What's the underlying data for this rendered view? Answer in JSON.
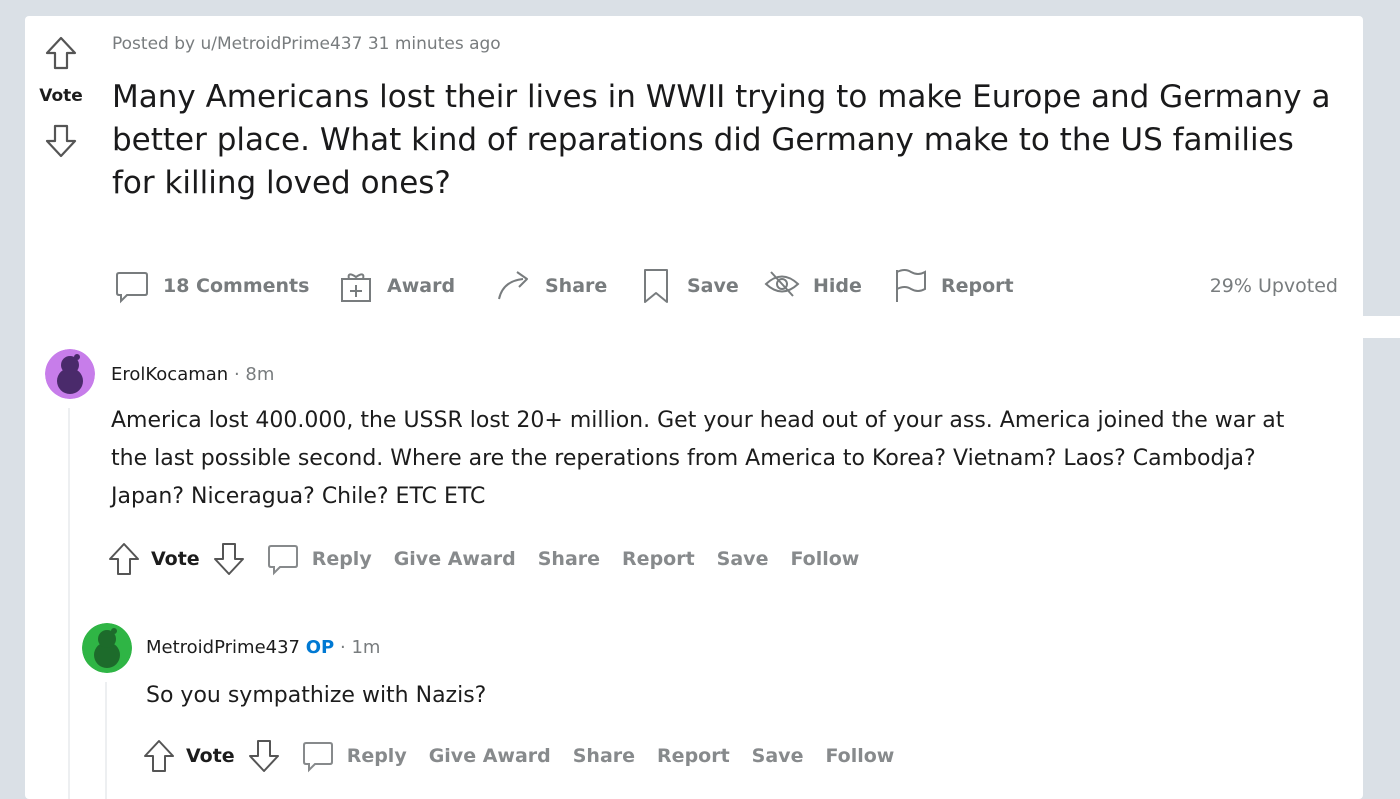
{
  "post": {
    "vote_label": "Vote",
    "posted_by": "Posted by u/MetroidPrime437 31 minutes ago",
    "title": "Many Americans lost their lives in WWII trying to make Europe and Germany a better place. What kind of reparations did Germany make to the US families for killing loved ones?",
    "actions": {
      "comments": "18 Comments",
      "award": "Award",
      "share": "Share",
      "save": "Save",
      "hide": "Hide",
      "report": "Report"
    },
    "upvoted": "29% Upvoted"
  },
  "comments": [
    {
      "author": "ErolKocaman",
      "separator": "·",
      "age": "8m",
      "op_badge": "",
      "body": "America lost 400.000, the USSR lost 20+ million. Get your head out of your ass. America joined the war at the last possible second. Where are the reperations from America to Korea? Vietnam? Laos? Cambodja? Japan? Niceragua? Chile? ETC ETC",
      "avatar_color": "#c77dea",
      "actions": {
        "vote": "Vote",
        "reply": "Reply",
        "give_award": "Give Award",
        "share": "Share",
        "report": "Report",
        "save": "Save",
        "follow": "Follow"
      }
    },
    {
      "author": "MetroidPrime437",
      "separator": "·",
      "age": "1m",
      "op_badge": "OP",
      "body": "So you sympathize with Nazis?",
      "avatar_color": "#2fb545",
      "actions": {
        "vote": "Vote",
        "reply": "Reply",
        "give_award": "Give Award",
        "share": "Share",
        "report": "Report",
        "save": "Save",
        "follow": "Follow"
      }
    }
  ],
  "colors": {
    "meta_grey": "#787c7e",
    "op_blue": "#0079d3",
    "page_bg": "#dae0e6"
  }
}
